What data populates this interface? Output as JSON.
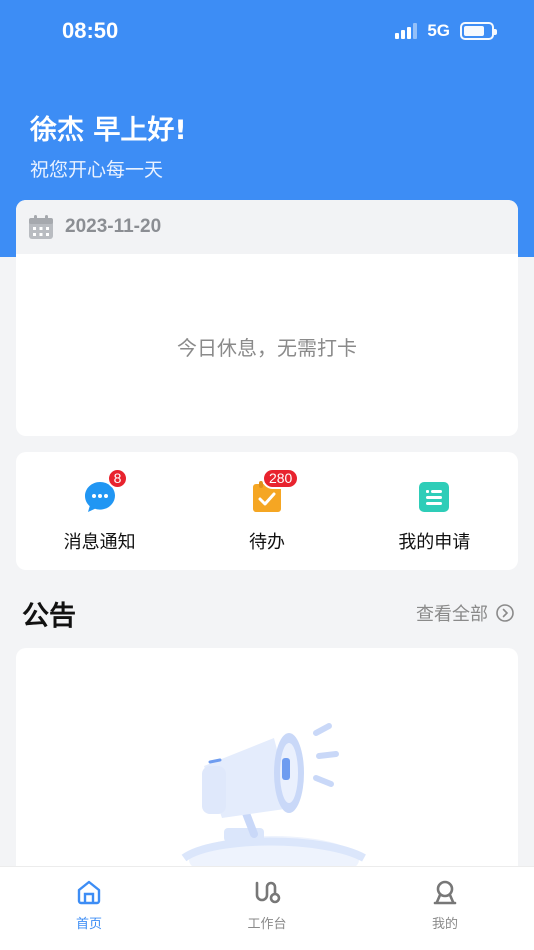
{
  "status_bar": {
    "time": "08:50",
    "network": "5G"
  },
  "header": {
    "greeting": "徐杰 早上好!",
    "subtitle": "祝您开心每一天"
  },
  "attendance": {
    "date": "2023-11-20",
    "message": "今日休息，无需打卡"
  },
  "quick_actions": [
    {
      "label": "消息通知",
      "badge": "8",
      "icon": "chat-bubble-icon",
      "color": "#2196f3"
    },
    {
      "label": "待办",
      "badge": "280",
      "icon": "todo-clipboard-icon",
      "color": "#f5a623"
    },
    {
      "label": "我的申请",
      "badge": "",
      "icon": "application-doc-icon",
      "color": "#2ecdb8"
    }
  ],
  "announcements": {
    "title": "公告",
    "view_all": "查看全部"
  },
  "tabbar": [
    {
      "label": "首页",
      "icon": "home-icon",
      "active": true
    },
    {
      "label": "工作台",
      "icon": "workbench-icon",
      "active": false
    },
    {
      "label": "我的",
      "icon": "profile-icon",
      "active": false
    }
  ],
  "colors": {
    "primary": "#3d8df5",
    "badge": "#e8232e"
  }
}
